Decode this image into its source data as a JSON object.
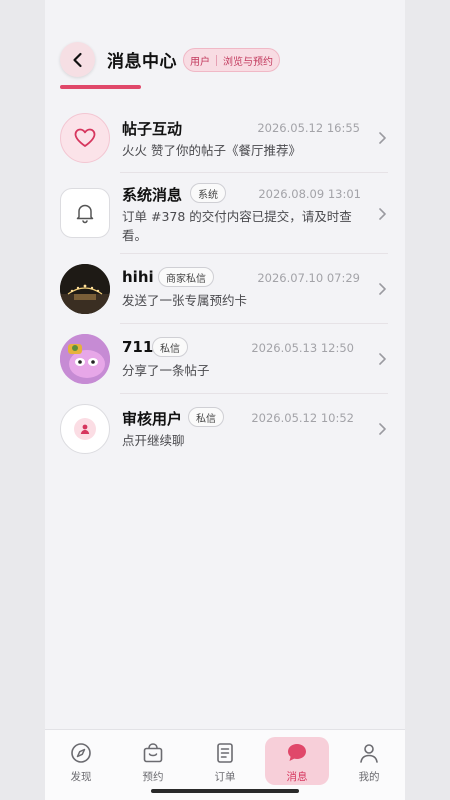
{
  "header": {
    "title": "消息中心",
    "mode": {
      "left": "用户",
      "right": "浏览与预约"
    }
  },
  "messages": [
    {
      "name": "帖子互动",
      "badge": "",
      "time": "2026.05.12 16:55",
      "text": "火火 赞了你的帖子《餐厅推荐》",
      "avatar": "heart-icon"
    },
    {
      "name": "系统消息",
      "badge": "系统",
      "time": "2026.08.09 13:01",
      "text": "订单 #378 的交付内容已提交，请及时查看。",
      "avatar": "bell-icon"
    },
    {
      "name": "hihi",
      "badge": "商家私信",
      "time": "2026.07.10 07:29",
      "text": "发送了一张专属预约卡",
      "avatar": "photo-night-scene"
    },
    {
      "name": "711",
      "badge": "私信",
      "time": "2026.05.13 12:50",
      "text": "分享了一条帖子",
      "avatar": "photo-cartoon"
    },
    {
      "name": "审核用户",
      "badge": "私信",
      "time": "2026.05.12 10:52",
      "text": "点开继续聊",
      "avatar": "user-icon"
    }
  ],
  "tabs": [
    {
      "label": "发现",
      "icon": "compass-icon",
      "active": false
    },
    {
      "label": "预约",
      "icon": "bag-icon",
      "active": false
    },
    {
      "label": "订单",
      "icon": "document-icon",
      "active": false
    },
    {
      "label": "消息",
      "icon": "chat-bubble-icon",
      "active": true
    },
    {
      "label": "我的",
      "icon": "person-icon",
      "active": false
    }
  ],
  "colors": {
    "accent": "#e0486a",
    "accent_soft": "#f7cfd9",
    "text_primary": "#111111",
    "text_secondary": "#a3a3a8"
  }
}
